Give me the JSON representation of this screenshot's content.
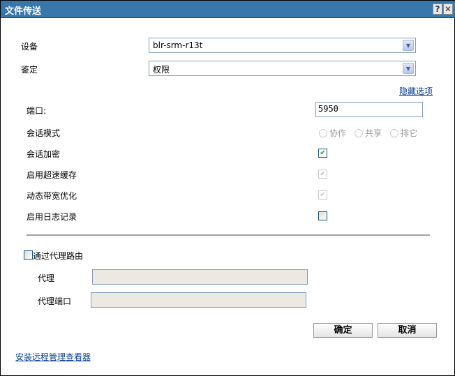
{
  "window": {
    "title": "文件传送",
    "help_label": "?",
    "close_label": "✕"
  },
  "device": {
    "label": "设备",
    "value": "blr-srm-r13t"
  },
  "auth": {
    "label": "鉴定",
    "value": "权限"
  },
  "hide_options": "隐藏选项",
  "port": {
    "label": "端口:",
    "value": "5950"
  },
  "session_mode": {
    "label": "会话模式",
    "options": [
      "协作",
      "共享",
      "排它"
    ]
  },
  "encrypt": {
    "label": "会话加密",
    "checked": true
  },
  "cache": {
    "label": "启用超速缓存",
    "checked": true,
    "disabled": true
  },
  "bandwidth": {
    "label": "动态带宽优化",
    "checked": true,
    "disabled": true
  },
  "logging": {
    "label": "启用日志记录",
    "checked": false
  },
  "proxy_route": {
    "label": "通过代理路由",
    "checked": false
  },
  "proxy": {
    "label": "代理",
    "value": ""
  },
  "proxy_port": {
    "label": "代理端口",
    "value": ""
  },
  "ok_label": "确定",
  "cancel_label": "取消",
  "install_link": "安装远程管理查看器"
}
